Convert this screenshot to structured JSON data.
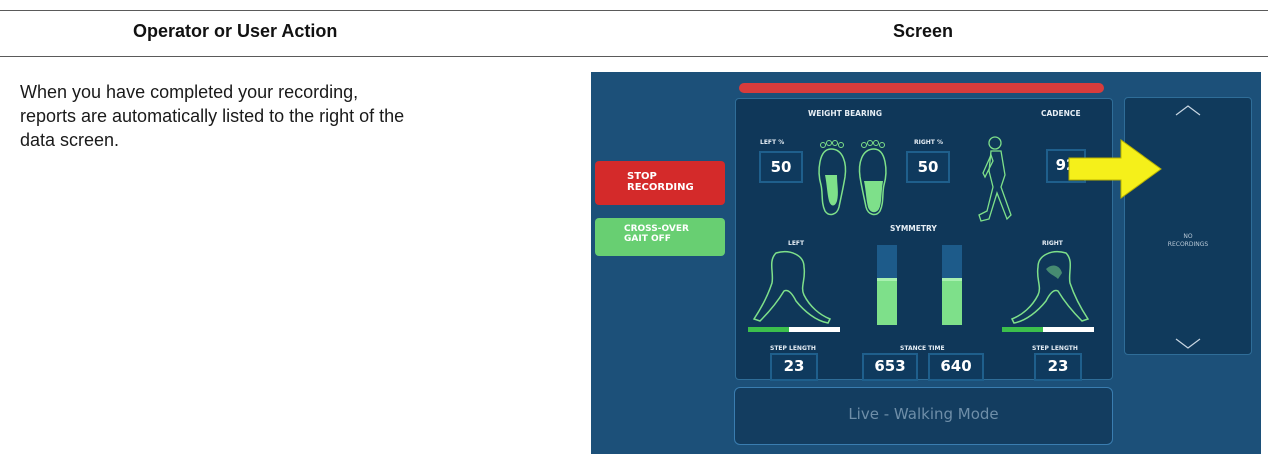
{
  "table": {
    "col_action_header": "Operator or User Action",
    "col_screen_header": "Screen",
    "instruction": "When you have completed your recording, reports are automatically listed to the right of the data screen."
  },
  "screen": {
    "buttons": {
      "stop_recording": [
        "STOP",
        "RECORDING"
      ],
      "cross_over": [
        "CROSS-OVER",
        "GAIT OFF"
      ]
    },
    "weight_bearing": {
      "title": "WEIGHT BEARING",
      "left_label": "LEFT %",
      "left_value": "50",
      "right_label": "RIGHT %",
      "right_value": "50"
    },
    "cadence": {
      "title": "CADENCE",
      "value": "92"
    },
    "symmetry": {
      "title": "SYMMETRY",
      "left_label": "LEFT",
      "right_label": "RIGHT",
      "left_bar_fill": 0.55,
      "right_bar_fill": 0.55
    },
    "step_length_left": {
      "label": "STEP LENGTH",
      "value": "23"
    },
    "stance_time": {
      "label": "STANCE TIME",
      "left_value": "653",
      "right_value": "640"
    },
    "step_length_right": {
      "label": "STEP LENGTH",
      "value": "23"
    },
    "status": "Live - Walking Mode",
    "recordings_panel": [
      "NO",
      "RECORDINGS"
    ],
    "colors": {
      "screen_bg": "#1c5079",
      "panel_bg": "#0f3759",
      "stop_button": "#d42a2a",
      "cross_button": "#68cf72",
      "foot_fill": "#7ee08a",
      "callout_arrow": "#f5f01a"
    },
    "icons": [
      "foot-outline-icon",
      "foot-filled-icon",
      "walking-figure-icon",
      "leg-outline-icon",
      "chevron-up-icon",
      "chevron-down-icon",
      "callout-arrow-icon"
    ]
  }
}
